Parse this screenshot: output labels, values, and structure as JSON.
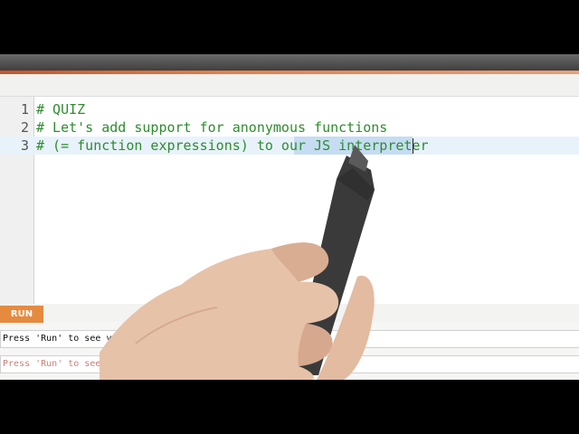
{
  "editor": {
    "lines": [
      {
        "number": "1",
        "text": "# QUIZ"
      },
      {
        "number": "2",
        "text": "# Let's add support for anonymous functions"
      },
      {
        "number": "3",
        "text": "# (= function expressions) to our JS interpreter",
        "selected": "JS interpreter"
      }
    ]
  },
  "toolbar": {
    "run_label": "RUN"
  },
  "output": {
    "result_text": "Press 'Run' to see your result",
    "result_echo": "Press 'Run' to see your result"
  },
  "colors": {
    "accent": "#e58b3f",
    "comment": "#2f8c2f",
    "selection": "#c5dcf3"
  },
  "overlay": {
    "description_icon": "hand-with-pen-icon"
  }
}
